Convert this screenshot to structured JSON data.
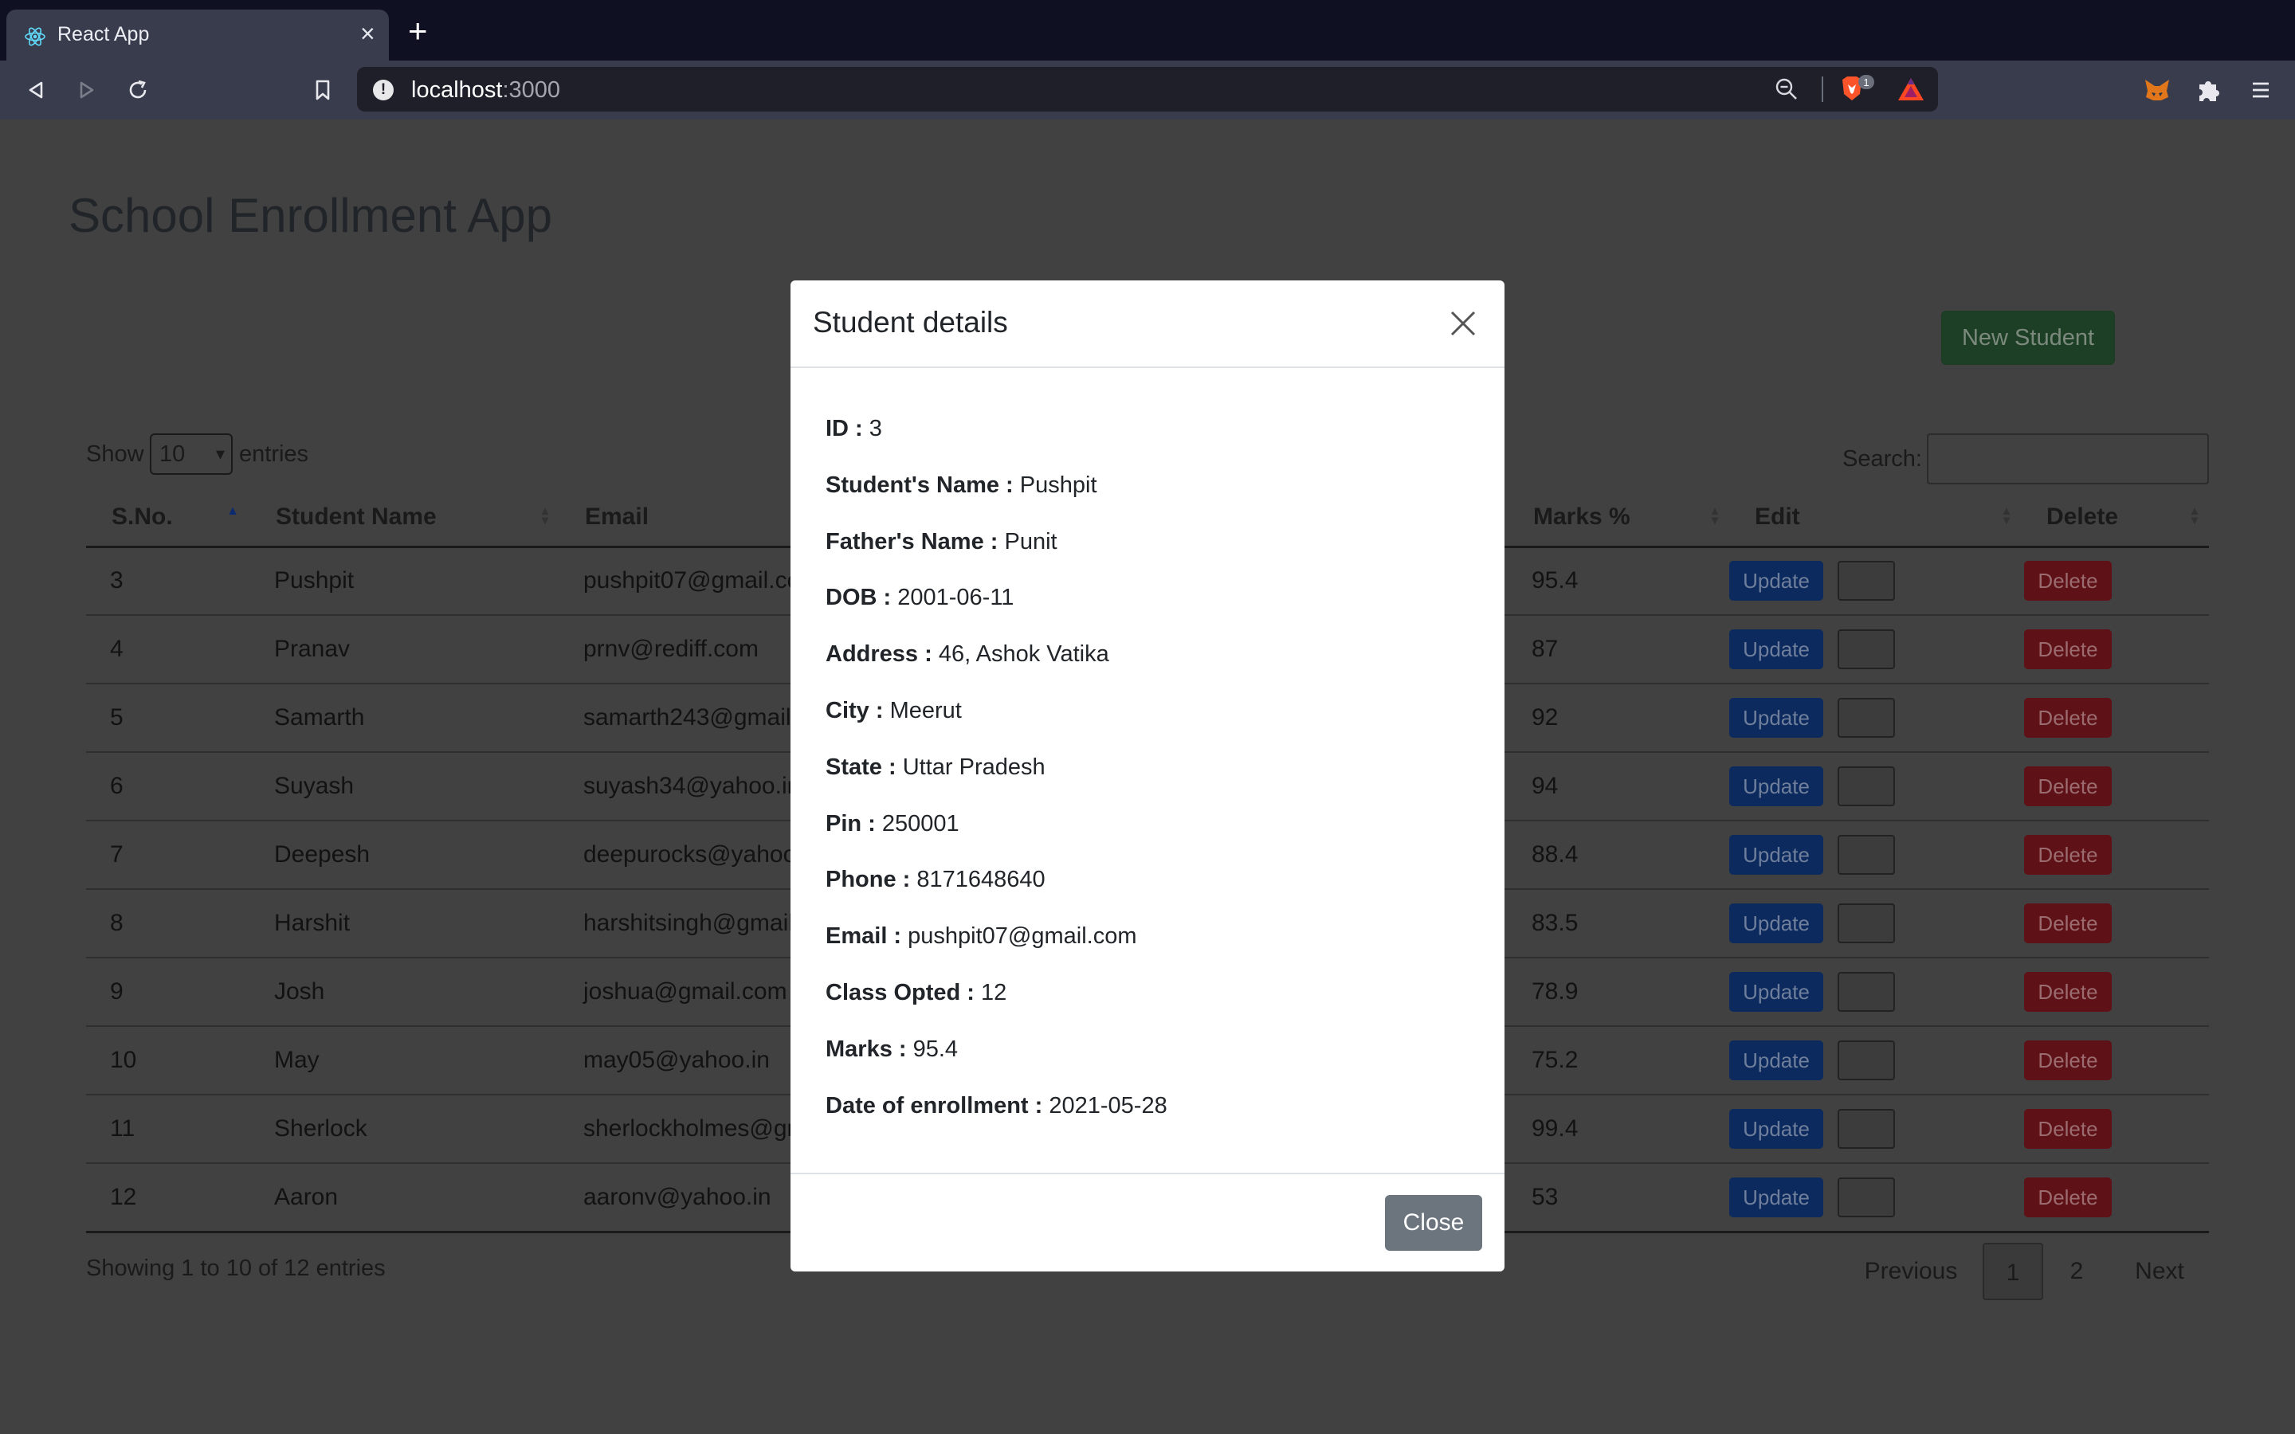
{
  "browser": {
    "tab_title": "React App",
    "tab_close": "×",
    "new_tab": "+",
    "url_host": "localhost",
    "url_port": ":3000",
    "brave_badge": "1"
  },
  "page": {
    "title": "School Enrollment App",
    "new_student_label": "New Student",
    "show_label": "Show",
    "entries_label": "entries",
    "page_length": "10",
    "search_label": "Search:",
    "search_value": "",
    "info": "Showing 1 to 10 of 12 entries",
    "pagination": {
      "previous": "Previous",
      "pages": [
        "1",
        "2"
      ],
      "current": "1",
      "next": "Next"
    }
  },
  "table": {
    "headers": [
      "S.No.",
      "Student Name",
      "Email",
      "Marks %",
      "Edit",
      "Delete"
    ],
    "update_label": "Update",
    "delete_label": "Delete",
    "rows": [
      {
        "sno": "3",
        "name": "Pushpit",
        "email": "pushpit07@gmail.co",
        "marks": "95.4"
      },
      {
        "sno": "4",
        "name": "Pranav",
        "email": "prnv@rediff.com",
        "marks": "87"
      },
      {
        "sno": "5",
        "name": "Samarth",
        "email": "samarth243@gmail",
        "marks": "92"
      },
      {
        "sno": "6",
        "name": "Suyash",
        "email": "suyash34@yahoo.in",
        "marks": "94"
      },
      {
        "sno": "7",
        "name": "Deepesh",
        "email": "deepurocks@yahoo",
        "marks": "88.4"
      },
      {
        "sno": "8",
        "name": "Harshit",
        "email": "harshitsingh@gmail",
        "marks": "83.5"
      },
      {
        "sno": "9",
        "name": "Josh",
        "email": "joshua@gmail.com",
        "marks": "78.9"
      },
      {
        "sno": "10",
        "name": "May",
        "email": "may05@yahoo.in",
        "marks": "75.2"
      },
      {
        "sno": "11",
        "name": "Sherlock",
        "email": "sherlockholmes@gr",
        "marks": "99.4"
      },
      {
        "sno": "12",
        "name": "Aaron",
        "email": "aaronv@yahoo.in",
        "marks": "53"
      }
    ]
  },
  "modal": {
    "title": "Student details",
    "close_label": "Close",
    "fields": [
      {
        "label": "ID :",
        "value": "3"
      },
      {
        "label": "Student's Name :",
        "value": "Pushpit"
      },
      {
        "label": "Father's Name :",
        "value": "Punit"
      },
      {
        "label": "DOB :",
        "value": "2001-06-11"
      },
      {
        "label": "Address :",
        "value": "46, Ashok Vatika"
      },
      {
        "label": "City :",
        "value": "Meerut"
      },
      {
        "label": "State :",
        "value": "Uttar Pradesh"
      },
      {
        "label": "Pin :",
        "value": "250001"
      },
      {
        "label": "Phone :",
        "value": "8171648640"
      },
      {
        "label": "Email :",
        "value": "pushpit07@gmail.com"
      },
      {
        "label": "Class Opted :",
        "value": "12"
      },
      {
        "label": "Marks :",
        "value": "95.4"
      },
      {
        "label": "Date of enrollment :",
        "value": "2021-05-28"
      }
    ]
  },
  "colors": {
    "backdrop": "#414141",
    "update_button": "#0c2a5e",
    "delete_button": "#5e1116",
    "new_student_button": "#1d3f25",
    "close_button": "#6c757d"
  },
  "icons": [
    "react-icon",
    "back-icon",
    "forward-icon",
    "reload-icon",
    "bookmark-icon",
    "info-icon",
    "zoom-out-icon",
    "brave-shield-icon",
    "bat-rewards-icon",
    "metamask-icon",
    "extensions-icon",
    "menu-icon",
    "sort-icon",
    "close-icon"
  ]
}
